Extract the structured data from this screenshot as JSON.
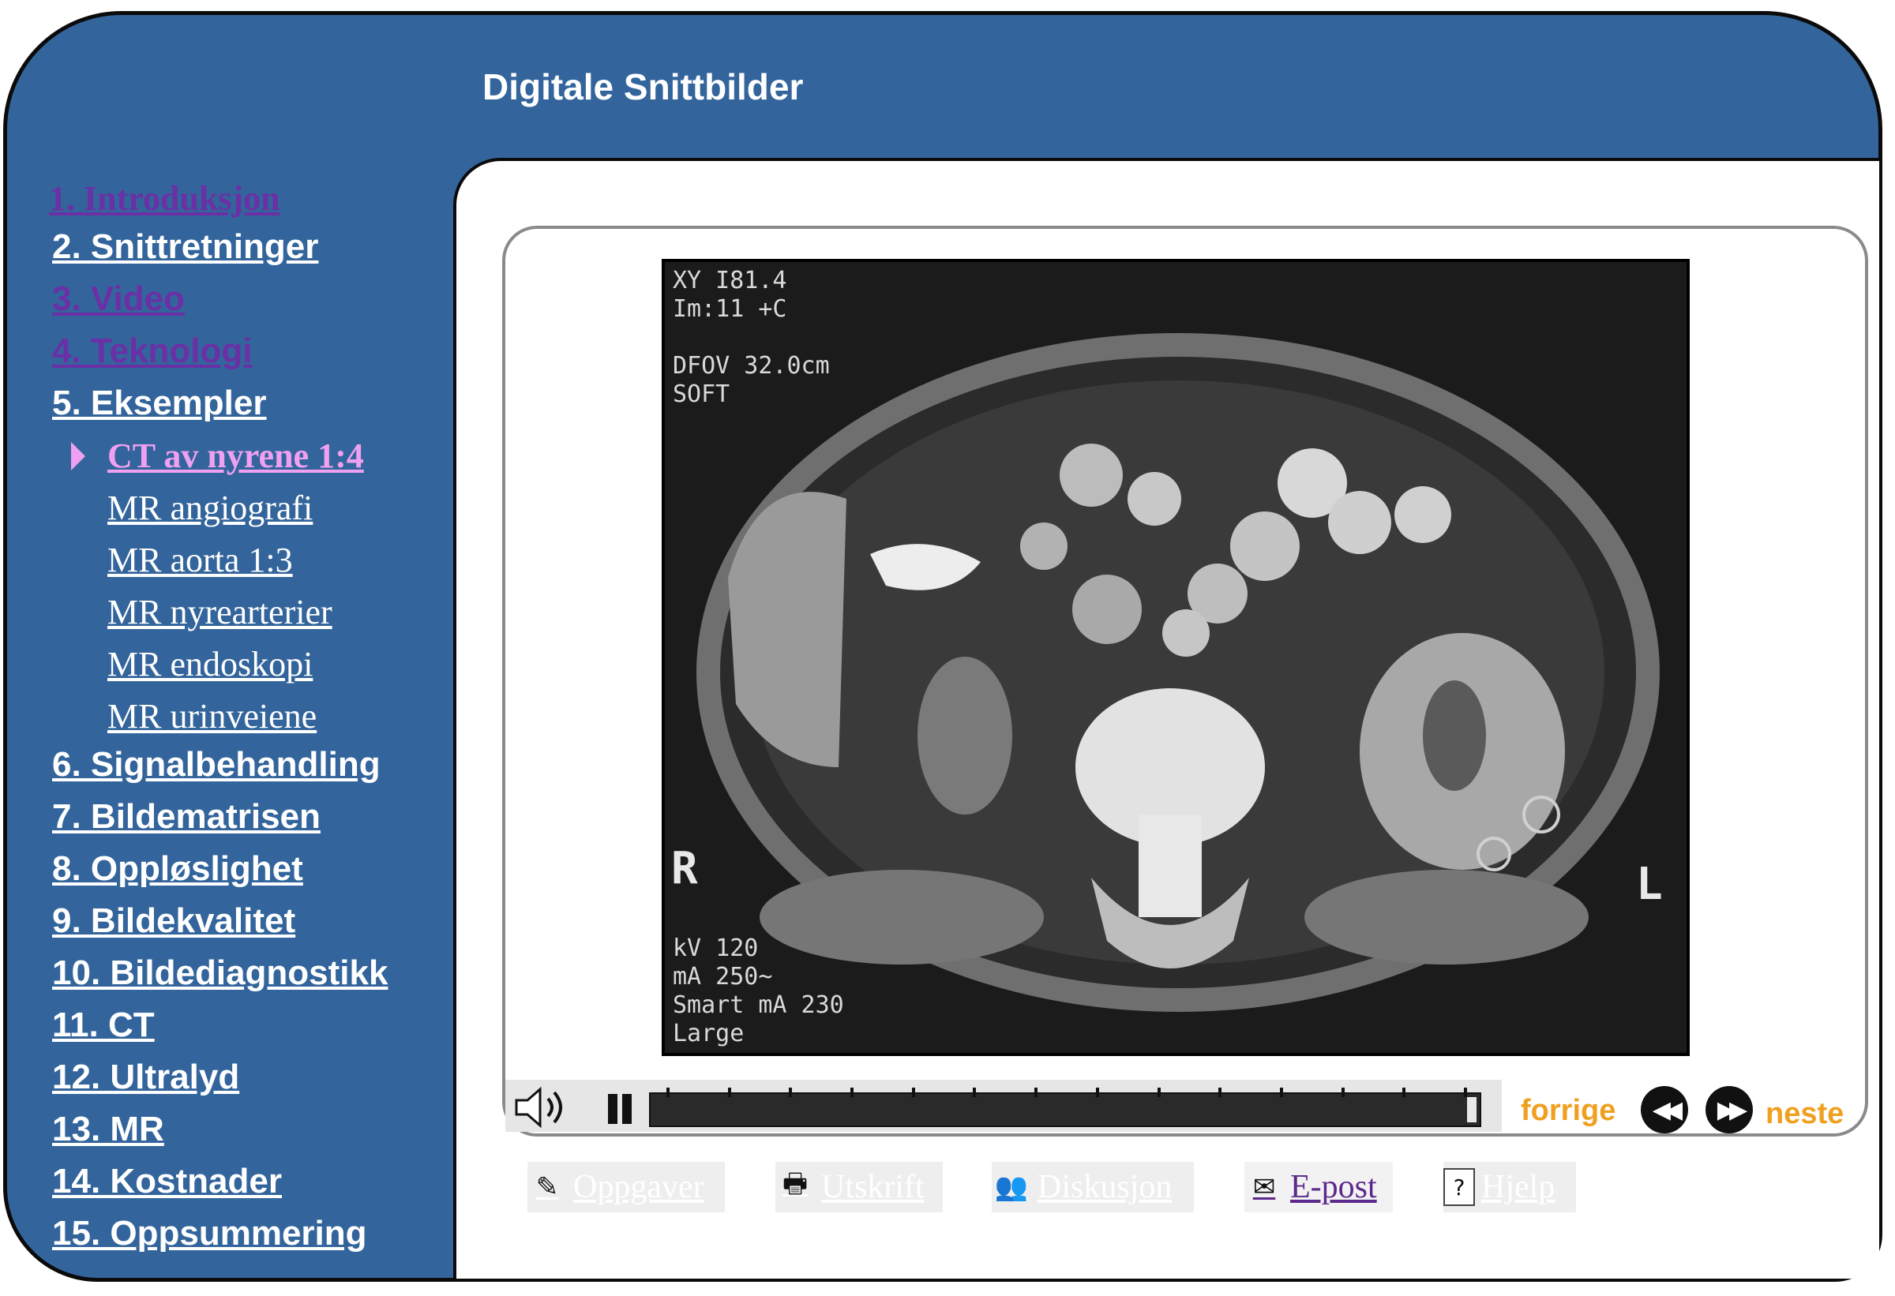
{
  "header": {
    "title": "Digitale Snittbilder"
  },
  "nav": {
    "items": [
      {
        "label": "1. Introduksjon"
      },
      {
        "label": "2. Snittretninger"
      },
      {
        "label": "3. Video"
      },
      {
        "label": "4. Teknologi"
      },
      {
        "label": "5. Eksempler"
      },
      {
        "label": "CT av nyrene 1:4"
      },
      {
        "label": "MR angiografi"
      },
      {
        "label": "MR aorta 1:3"
      },
      {
        "label": "MR nyrearterier"
      },
      {
        "label": "MR endoskopi"
      },
      {
        "label": "MR urinveiene"
      },
      {
        "label": "6. Signalbehandling"
      },
      {
        "label": "7. Bildematrisen"
      },
      {
        "label": "8. Oppløslighet"
      },
      {
        "label": "9. Bildekvalitet"
      },
      {
        "label": "10. Bildediagnostikk"
      },
      {
        "label": "11. CT"
      },
      {
        "label": "12. Ultralyd"
      },
      {
        "label": "13. MR"
      },
      {
        "label": "14. Kostnader"
      },
      {
        "label": "15. Oppsummering"
      }
    ]
  },
  "image": {
    "top_left_text": "XY I81.4\nIm:11 +C\n\nDFOV 32.0cm\nSOFT",
    "bottom_left_text": "kV 120\nmA 250~\nSmart mA 230\nLarge",
    "right_marker": "R",
    "left_marker": "L"
  },
  "player": {
    "progress": 1.0,
    "prev_label": "forrige",
    "next_label": "neste",
    "prev_icon": "rewind-icon",
    "next_icon": "fast-forward-icon"
  },
  "toolbar": {
    "tasks_label": "Oppgaver",
    "print_label": "Utskrift",
    "discussion_label": "Diskusjon",
    "email_label": "E-post",
    "help_label": "Hjelp",
    "help_icon_text": "?"
  },
  "colors": {
    "frame_blue": "#33659c",
    "visited_link": "#6b2fa6",
    "active_link": "#f0a0f0",
    "player_accent": "#f0a020"
  }
}
